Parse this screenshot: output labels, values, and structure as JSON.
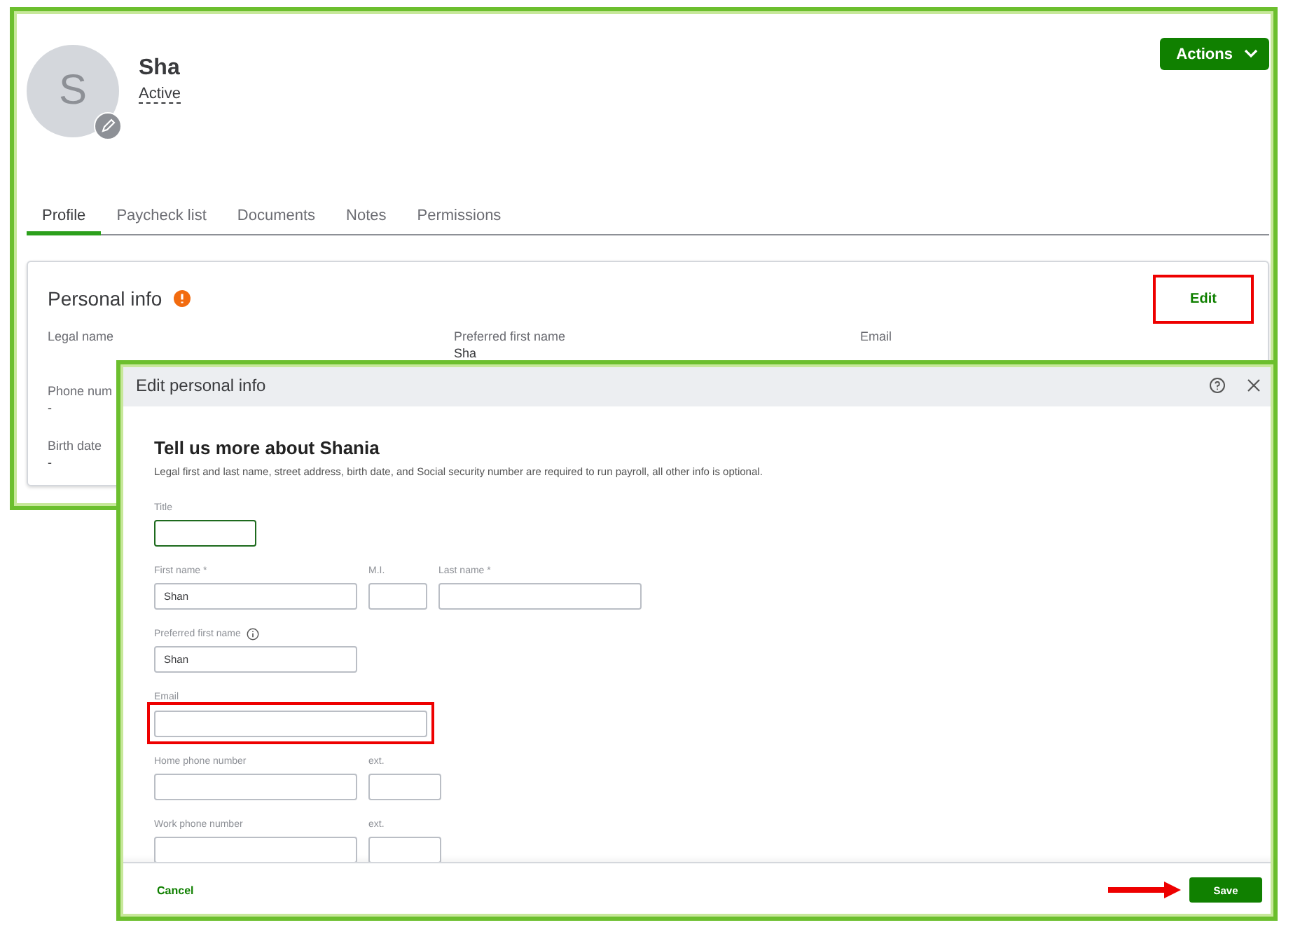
{
  "profile": {
    "avatar_initial": "S",
    "name": "Sha",
    "status": "Active"
  },
  "actions_button": {
    "label": "Actions"
  },
  "tabs": [
    {
      "label": "Profile",
      "selected": true
    },
    {
      "label": "Paycheck list",
      "selected": false
    },
    {
      "label": "Documents",
      "selected": false
    },
    {
      "label": "Notes",
      "selected": false
    },
    {
      "label": "Permissions",
      "selected": false
    }
  ],
  "personal_info": {
    "title": "Personal info",
    "warning": true,
    "edit_button": {
      "label": "Edit",
      "highlighted": true
    },
    "rows": [
      [
        {
          "label": "Legal name"
        },
        {
          "label": "Preferred first name",
          "value": "Sha"
        },
        {
          "label": "Email"
        }
      ],
      [
        {
          "label": "Phone num",
          "value": "-"
        }
      ],
      [
        {
          "label": "Birth date",
          "value": "-"
        }
      ]
    ]
  },
  "dialog": {
    "title": "Edit personal info",
    "heading": "Tell us more about Shania",
    "note": "Legal first and last name, street address, birth date, and Social security number are required to run payroll, all other info is optional.",
    "rows": [
      [
        {
          "label": "Title",
          "kind": "title",
          "focused": true
        }
      ],
      [
        {
          "label": "First name *",
          "value": "Shan",
          "kind": "name",
          "focused": false
        },
        {
          "label": "M.I.",
          "kind": "initial",
          "focused": false
        },
        {
          "label": "Last name *",
          "kind": "name",
          "focused": false
        }
      ],
      [
        {
          "label": "Preferred first name",
          "value": "Shan",
          "kind": "name",
          "focused": false,
          "info": true
        }
      ],
      [
        {
          "label": "Email",
          "kind": "email",
          "focused": false,
          "highlighted": true
        }
      ],
      [
        {
          "label": "Home phone number",
          "kind": "phone",
          "focused": false
        },
        {
          "label": "ext.",
          "kind": "ext",
          "focused": false
        }
      ],
      [
        {
          "label": "Work phone number",
          "kind": "phone",
          "focused": false
        },
        {
          "label": "ext.",
          "kind": "ext",
          "focused": false
        }
      ]
    ],
    "cancel_button": {
      "label": "Cancel"
    },
    "save_button": {
      "label": "Save",
      "pointer_arrow": true
    }
  }
}
